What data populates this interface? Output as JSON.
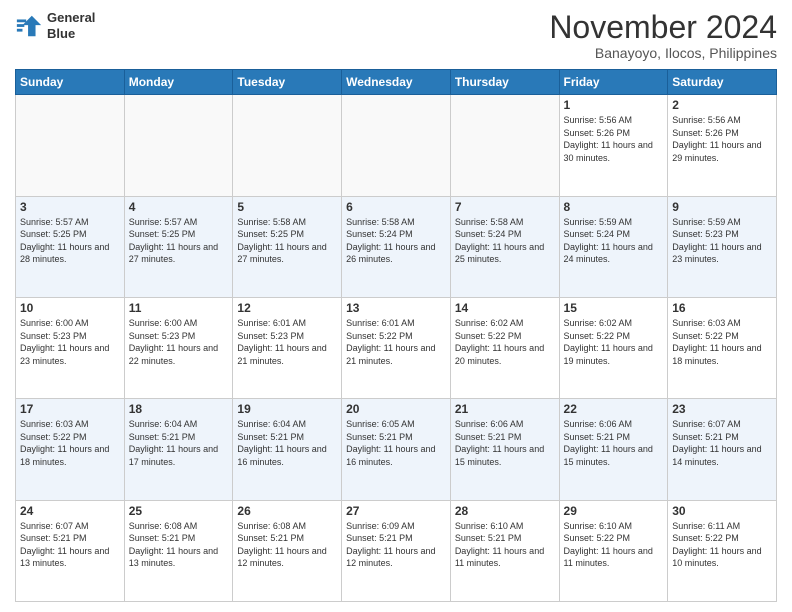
{
  "header": {
    "logo_line1": "General",
    "logo_line2": "Blue",
    "month": "November 2024",
    "location": "Banayoyo, Ilocos, Philippines"
  },
  "days_of_week": [
    "Sunday",
    "Monday",
    "Tuesday",
    "Wednesday",
    "Thursday",
    "Friday",
    "Saturday"
  ],
  "weeks": [
    [
      {
        "day": "",
        "sunrise": "",
        "sunset": "",
        "daylight": ""
      },
      {
        "day": "",
        "sunrise": "",
        "sunset": "",
        "daylight": ""
      },
      {
        "day": "",
        "sunrise": "",
        "sunset": "",
        "daylight": ""
      },
      {
        "day": "",
        "sunrise": "",
        "sunset": "",
        "daylight": ""
      },
      {
        "day": "",
        "sunrise": "",
        "sunset": "",
        "daylight": ""
      },
      {
        "day": "1",
        "sunrise": "Sunrise: 5:56 AM",
        "sunset": "Sunset: 5:26 PM",
        "daylight": "Daylight: 11 hours and 30 minutes."
      },
      {
        "day": "2",
        "sunrise": "Sunrise: 5:56 AM",
        "sunset": "Sunset: 5:26 PM",
        "daylight": "Daylight: 11 hours and 29 minutes."
      }
    ],
    [
      {
        "day": "3",
        "sunrise": "Sunrise: 5:57 AM",
        "sunset": "Sunset: 5:25 PM",
        "daylight": "Daylight: 11 hours and 28 minutes."
      },
      {
        "day": "4",
        "sunrise": "Sunrise: 5:57 AM",
        "sunset": "Sunset: 5:25 PM",
        "daylight": "Daylight: 11 hours and 27 minutes."
      },
      {
        "day": "5",
        "sunrise": "Sunrise: 5:58 AM",
        "sunset": "Sunset: 5:25 PM",
        "daylight": "Daylight: 11 hours and 27 minutes."
      },
      {
        "day": "6",
        "sunrise": "Sunrise: 5:58 AM",
        "sunset": "Sunset: 5:24 PM",
        "daylight": "Daylight: 11 hours and 26 minutes."
      },
      {
        "day": "7",
        "sunrise": "Sunrise: 5:58 AM",
        "sunset": "Sunset: 5:24 PM",
        "daylight": "Daylight: 11 hours and 25 minutes."
      },
      {
        "day": "8",
        "sunrise": "Sunrise: 5:59 AM",
        "sunset": "Sunset: 5:24 PM",
        "daylight": "Daylight: 11 hours and 24 minutes."
      },
      {
        "day": "9",
        "sunrise": "Sunrise: 5:59 AM",
        "sunset": "Sunset: 5:23 PM",
        "daylight": "Daylight: 11 hours and 23 minutes."
      }
    ],
    [
      {
        "day": "10",
        "sunrise": "Sunrise: 6:00 AM",
        "sunset": "Sunset: 5:23 PM",
        "daylight": "Daylight: 11 hours and 23 minutes."
      },
      {
        "day": "11",
        "sunrise": "Sunrise: 6:00 AM",
        "sunset": "Sunset: 5:23 PM",
        "daylight": "Daylight: 11 hours and 22 minutes."
      },
      {
        "day": "12",
        "sunrise": "Sunrise: 6:01 AM",
        "sunset": "Sunset: 5:23 PM",
        "daylight": "Daylight: 11 hours and 21 minutes."
      },
      {
        "day": "13",
        "sunrise": "Sunrise: 6:01 AM",
        "sunset": "Sunset: 5:22 PM",
        "daylight": "Daylight: 11 hours and 21 minutes."
      },
      {
        "day": "14",
        "sunrise": "Sunrise: 6:02 AM",
        "sunset": "Sunset: 5:22 PM",
        "daylight": "Daylight: 11 hours and 20 minutes."
      },
      {
        "day": "15",
        "sunrise": "Sunrise: 6:02 AM",
        "sunset": "Sunset: 5:22 PM",
        "daylight": "Daylight: 11 hours and 19 minutes."
      },
      {
        "day": "16",
        "sunrise": "Sunrise: 6:03 AM",
        "sunset": "Sunset: 5:22 PM",
        "daylight": "Daylight: 11 hours and 18 minutes."
      }
    ],
    [
      {
        "day": "17",
        "sunrise": "Sunrise: 6:03 AM",
        "sunset": "Sunset: 5:22 PM",
        "daylight": "Daylight: 11 hours and 18 minutes."
      },
      {
        "day": "18",
        "sunrise": "Sunrise: 6:04 AM",
        "sunset": "Sunset: 5:21 PM",
        "daylight": "Daylight: 11 hours and 17 minutes."
      },
      {
        "day": "19",
        "sunrise": "Sunrise: 6:04 AM",
        "sunset": "Sunset: 5:21 PM",
        "daylight": "Daylight: 11 hours and 16 minutes."
      },
      {
        "day": "20",
        "sunrise": "Sunrise: 6:05 AM",
        "sunset": "Sunset: 5:21 PM",
        "daylight": "Daylight: 11 hours and 16 minutes."
      },
      {
        "day": "21",
        "sunrise": "Sunrise: 6:06 AM",
        "sunset": "Sunset: 5:21 PM",
        "daylight": "Daylight: 11 hours and 15 minutes."
      },
      {
        "day": "22",
        "sunrise": "Sunrise: 6:06 AM",
        "sunset": "Sunset: 5:21 PM",
        "daylight": "Daylight: 11 hours and 15 minutes."
      },
      {
        "day": "23",
        "sunrise": "Sunrise: 6:07 AM",
        "sunset": "Sunset: 5:21 PM",
        "daylight": "Daylight: 11 hours and 14 minutes."
      }
    ],
    [
      {
        "day": "24",
        "sunrise": "Sunrise: 6:07 AM",
        "sunset": "Sunset: 5:21 PM",
        "daylight": "Daylight: 11 hours and 13 minutes."
      },
      {
        "day": "25",
        "sunrise": "Sunrise: 6:08 AM",
        "sunset": "Sunset: 5:21 PM",
        "daylight": "Daylight: 11 hours and 13 minutes."
      },
      {
        "day": "26",
        "sunrise": "Sunrise: 6:08 AM",
        "sunset": "Sunset: 5:21 PM",
        "daylight": "Daylight: 11 hours and 12 minutes."
      },
      {
        "day": "27",
        "sunrise": "Sunrise: 6:09 AM",
        "sunset": "Sunset: 5:21 PM",
        "daylight": "Daylight: 11 hours and 12 minutes."
      },
      {
        "day": "28",
        "sunrise": "Sunrise: 6:10 AM",
        "sunset": "Sunset: 5:21 PM",
        "daylight": "Daylight: 11 hours and 11 minutes."
      },
      {
        "day": "29",
        "sunrise": "Sunrise: 6:10 AM",
        "sunset": "Sunset: 5:22 PM",
        "daylight": "Daylight: 11 hours and 11 minutes."
      },
      {
        "day": "30",
        "sunrise": "Sunrise: 6:11 AM",
        "sunset": "Sunset: 5:22 PM",
        "daylight": "Daylight: 11 hours and 10 minutes."
      }
    ]
  ]
}
